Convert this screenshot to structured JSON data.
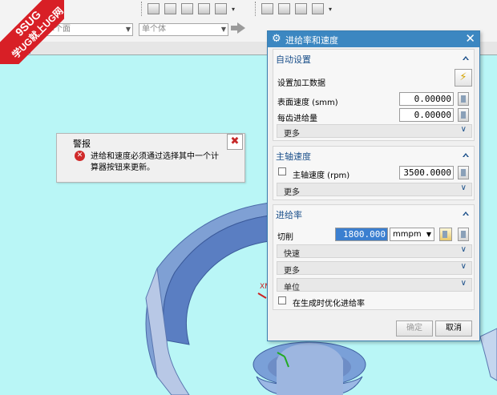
{
  "watermark": {
    "line1": "9SUG",
    "line2": "学UG就上UG网"
  },
  "selection_bar": {
    "filter1_value": "单个面",
    "filter2_value": "单个体"
  },
  "alert": {
    "title": "警报",
    "message": "进给和速度必须通过选择其中一个计算器按钮来更新。",
    "close_symbol": "✖"
  },
  "dialog": {
    "title": "进给率和速度",
    "close_symbol": "✕",
    "auto_settings": {
      "header": "自动设置",
      "set_machining_data_label": "设置加工数据",
      "surface_speed_label": "表面速度 (smm)",
      "surface_speed_value": "0.00000",
      "feed_per_tooth_label": "每齿进给量",
      "feed_per_tooth_value": "0.00000",
      "more_label": "更多"
    },
    "spindle": {
      "header": "主轴速度",
      "spindle_speed_label": "主轴速度 (rpm)",
      "spindle_speed_value": "3500.0000",
      "spindle_checked": false,
      "more_label": "更多"
    },
    "feed_rate": {
      "header": "进给率",
      "cut_label": "切削",
      "cut_value": "1800.000",
      "unit_value": "mmpm",
      "rapid_label": "快速",
      "more_label": "更多",
      "units_label": "单位",
      "optimize_label": "在生成时优化进给率",
      "optimize_checked": false
    },
    "ok_label": "确定",
    "cancel_label": "取消"
  },
  "colors": {
    "viewport_bg": "#b9f6f6",
    "titlebar_blue": "#3c87c1",
    "section_header": "#1a4f8a",
    "error_red": "#d02a2a",
    "selection_highlight": "#3b7fd0"
  },
  "icons": [
    "gear-icon",
    "close-icon",
    "error-icon",
    "lightning-icon",
    "calculator-icon",
    "lock-icon",
    "chevron-down-icon",
    "chevron-up-icon",
    "arrow-right-icon"
  ]
}
